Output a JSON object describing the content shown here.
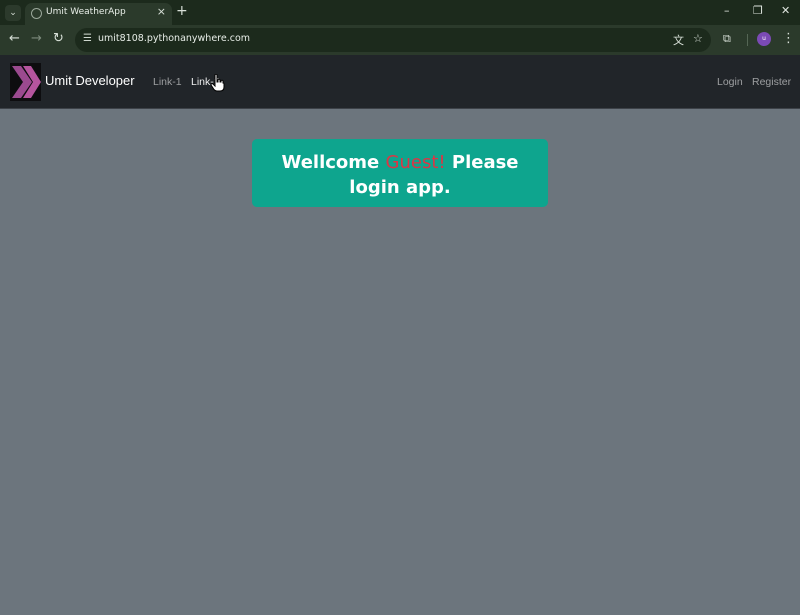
{
  "browser": {
    "tab_title": "Umit WeatherApp",
    "url": "umit8108.pythonanywhere.com",
    "profile_initials": "u",
    "icons": [
      "tab-search-icon",
      "globe-icon",
      "close-icon",
      "plus-icon",
      "minimize-icon",
      "restore-icon",
      "back-icon",
      "forward-icon",
      "reload-icon",
      "site-info-icon",
      "translate-icon",
      "star-icon",
      "extensions-icon",
      "menu-icon"
    ]
  },
  "navbar": {
    "brand": "Umit Developer",
    "links": [
      {
        "label": "Link-1"
      },
      {
        "label": "Link-2"
      }
    ],
    "right_links": [
      {
        "label": "Login"
      },
      {
        "label": "Register"
      }
    ]
  },
  "alert": {
    "prefix": "Wellcome ",
    "highlight": "Guest!",
    "suffix": " Please login app.",
    "bg_color": "#0ea58e",
    "highlight_color": "#dc3545"
  },
  "colors": {
    "page_bg": "#6c757d",
    "navbar_bg": "#212529"
  }
}
